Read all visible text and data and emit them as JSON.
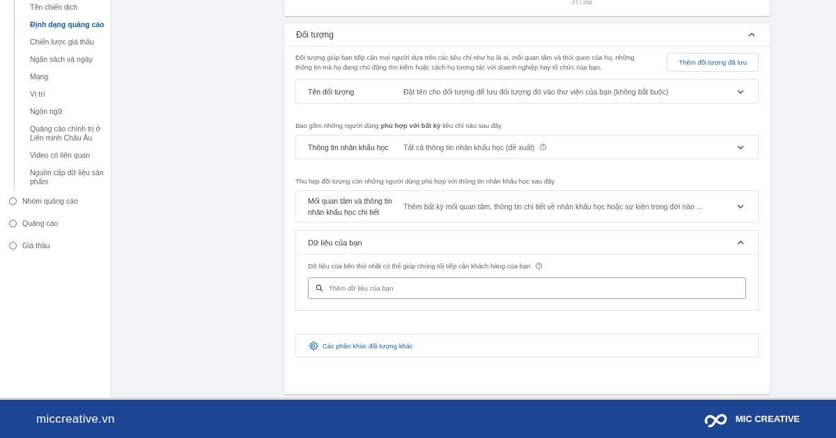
{
  "sidebar": {
    "sub_items": [
      {
        "label": "Tên chiến dịch",
        "selected": false
      },
      {
        "label": "Định dạng quảng cáo",
        "selected": true
      },
      {
        "label": "Chiến lược giá thầu",
        "selected": false
      },
      {
        "label": "Ngân sách và ngày",
        "selected": false
      },
      {
        "label": "Mạng",
        "selected": false
      },
      {
        "label": "Vị trí",
        "selected": false
      },
      {
        "label": "Ngôn ngữ",
        "selected": false
      },
      {
        "label": "Quảng cáo chính trị ở Liên minh Châu Âu",
        "selected": false
      },
      {
        "label": "Video có liên quan",
        "selected": false
      },
      {
        "label": "Nguồn cấp dữ liệu sản phẩm",
        "selected": false
      }
    ],
    "steps": [
      {
        "label": "Nhóm quảng cáo",
        "selected": false
      },
      {
        "label": "Quảng cáo",
        "selected": false
      },
      {
        "label": "Giá thầu",
        "selected": false
      }
    ]
  },
  "top_card": {
    "counter": "27 / 256"
  },
  "audience": {
    "title": "Đối tượng",
    "expanded": true,
    "description": "Đối tượng giúp bạn tiếp cận mọi người dựa trên các tiêu chí như họ là ai, mối quan tâm và thói quen của họ, những thông tin mà họ đang chủ động tìm kiếm hoặc cách họ tương tác với doanh nghiệp hay tổ chức của bạn.",
    "saved_button": "Thêm đối tượng đã lưu",
    "blocks": [
      {
        "kind": "row",
        "label": "Tên đối tượng",
        "value": "Đặt tên cho đối tượng để lưu đối tượng đó vào thư viện của bạn (không bắt buộc)",
        "help": false,
        "expanded": false
      },
      {
        "kind": "note",
        "text": "Bao gồm những người dùng **phù hợp với bất kỳ** tiêu chí nào sau đây"
      },
      {
        "kind": "row",
        "label": "Thông tin nhân khẩu học",
        "value": "Tất cả thông tin nhân khẩu học (đề xuất)",
        "help": true,
        "expanded": false
      },
      {
        "kind": "note",
        "text": "Thu hẹp đối tượng còn những người dùng phù hợp với thông tin nhân khẩu học sau đây"
      },
      {
        "kind": "row",
        "label": "Mối quan tâm và thông tin nhân khẩu học chi tiết",
        "value": "Thêm bất kỳ mối quan tâm, thông tin chi tiết về nhân khẩu học hoặc sự kiện trong đời nào ...",
        "help": false,
        "expanded": false
      },
      {
        "kind": "data",
        "title": "Dữ liệu của bạn",
        "expanded": true,
        "note": "Dữ liệu của bên thứ nhất có thể giúp chúng tôi tiếp cận khách hàng của bạn",
        "placeholder": "Thêm dữ liệu của bạn"
      },
      {
        "kind": "link",
        "label": "Các phân khúc đối tượng khác"
      }
    ]
  },
  "footer": {
    "site": "miccreative.vn",
    "brand": "MIC CREATIVE"
  }
}
